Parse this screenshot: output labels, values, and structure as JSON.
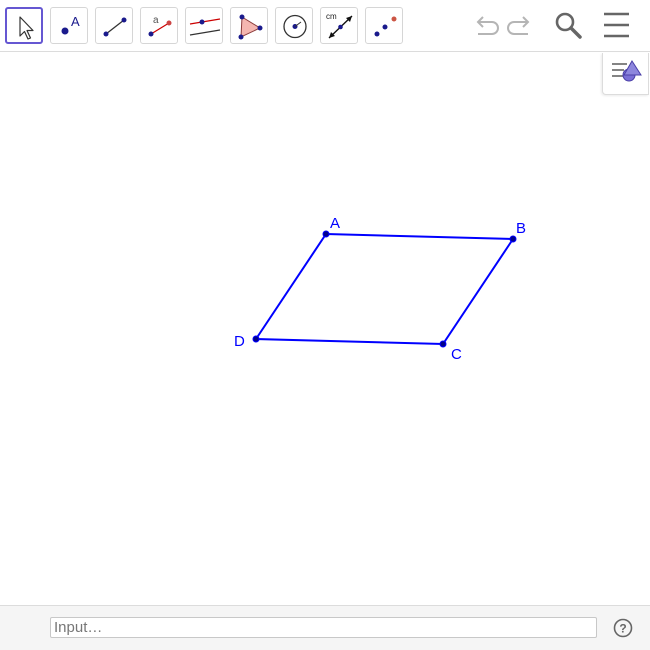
{
  "toolbar": {
    "tools": [
      {
        "name": "Move",
        "icon": "arrow-cursor-icon",
        "active": true
      },
      {
        "name": "Point",
        "icon": "point-icon"
      },
      {
        "name": "Segment",
        "icon": "segment-icon"
      },
      {
        "name": "Slider",
        "icon": "slider-icon"
      },
      {
        "name": "Parallel Line",
        "icon": "parallel-lines-icon"
      },
      {
        "name": "Polygon",
        "icon": "polygon-icon"
      },
      {
        "name": "Circle with Center",
        "icon": "circle-icon"
      },
      {
        "name": "Distance",
        "icon": "distance-icon",
        "label": "cm"
      },
      {
        "name": "Reflect",
        "icon": "reflect-icon"
      }
    ],
    "actions": [
      "undo-icon",
      "redo-icon",
      "search-icon",
      "menu-icon"
    ]
  },
  "graphics": {
    "points": [
      {
        "name": "A"
      },
      {
        "name": "B"
      },
      {
        "name": "C"
      },
      {
        "name": "D"
      }
    ],
    "polygon": "ABCD",
    "color": "#0000ff"
  },
  "style_bar": {
    "icon": "graphics-style-icon"
  },
  "input_bar": {
    "placeholder": "Input…",
    "value": ""
  },
  "help": {
    "icon": "help-icon",
    "label": "?"
  },
  "colors": {
    "accent": "#6557d2",
    "object": "#0000ff",
    "point_red": "#cc0000"
  }
}
